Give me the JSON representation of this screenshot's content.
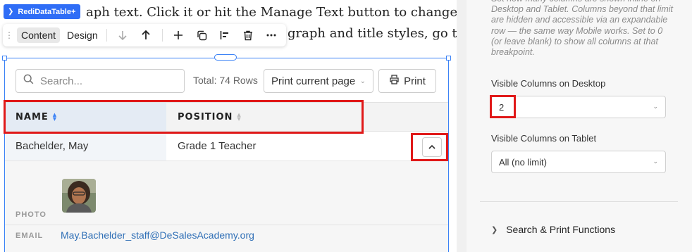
{
  "canvas": {
    "para_line1": "aph text. Click it or hit the Manage Text button to change the",
    "para_line2": "graph and title styles, go to S"
  },
  "widget_tag": {
    "label": "RediDataTable+",
    "icon": "chevron-right-icon"
  },
  "toolbar": {
    "content_tab": "Content",
    "design_tab": "Design",
    "icons": [
      "arrow-down-icon",
      "arrow-up-icon",
      "plus-icon",
      "duplicate-icon",
      "align-left-icon",
      "trash-icon",
      "more-icon"
    ]
  },
  "table": {
    "search_placeholder": "Search...",
    "total": "Total: 74 Rows",
    "print_select": "Print current page",
    "print_button": "Print",
    "columns": [
      "NAME",
      "POSITION"
    ],
    "row": {
      "name": "Bachelder, May",
      "position": "Grade 1 Teacher"
    },
    "detail": {
      "photo_label": "PHOTO",
      "email_label": "EMAIL",
      "email": "May.Bachelder_staff@DeSalesAcademy.org"
    }
  },
  "panel": {
    "help_text": "Set how many columns are shown inline on Desktop and Tablet. Columns beyond that limit are hidden and accessible via an expandable row — the same way Mobile works. Set to 0 (or leave blank) to show all columns at that breakpoint.",
    "desktop_label": "Visible Columns on Desktop",
    "desktop_value": "2",
    "tablet_label": "Visible Columns on Tablet",
    "tablet_value": "All (no limit)",
    "section_title": "Search & Print Functions"
  },
  "colors": {
    "accent": "#3b82f6",
    "highlight": "#e01919",
    "link": "#2f6fb6"
  }
}
